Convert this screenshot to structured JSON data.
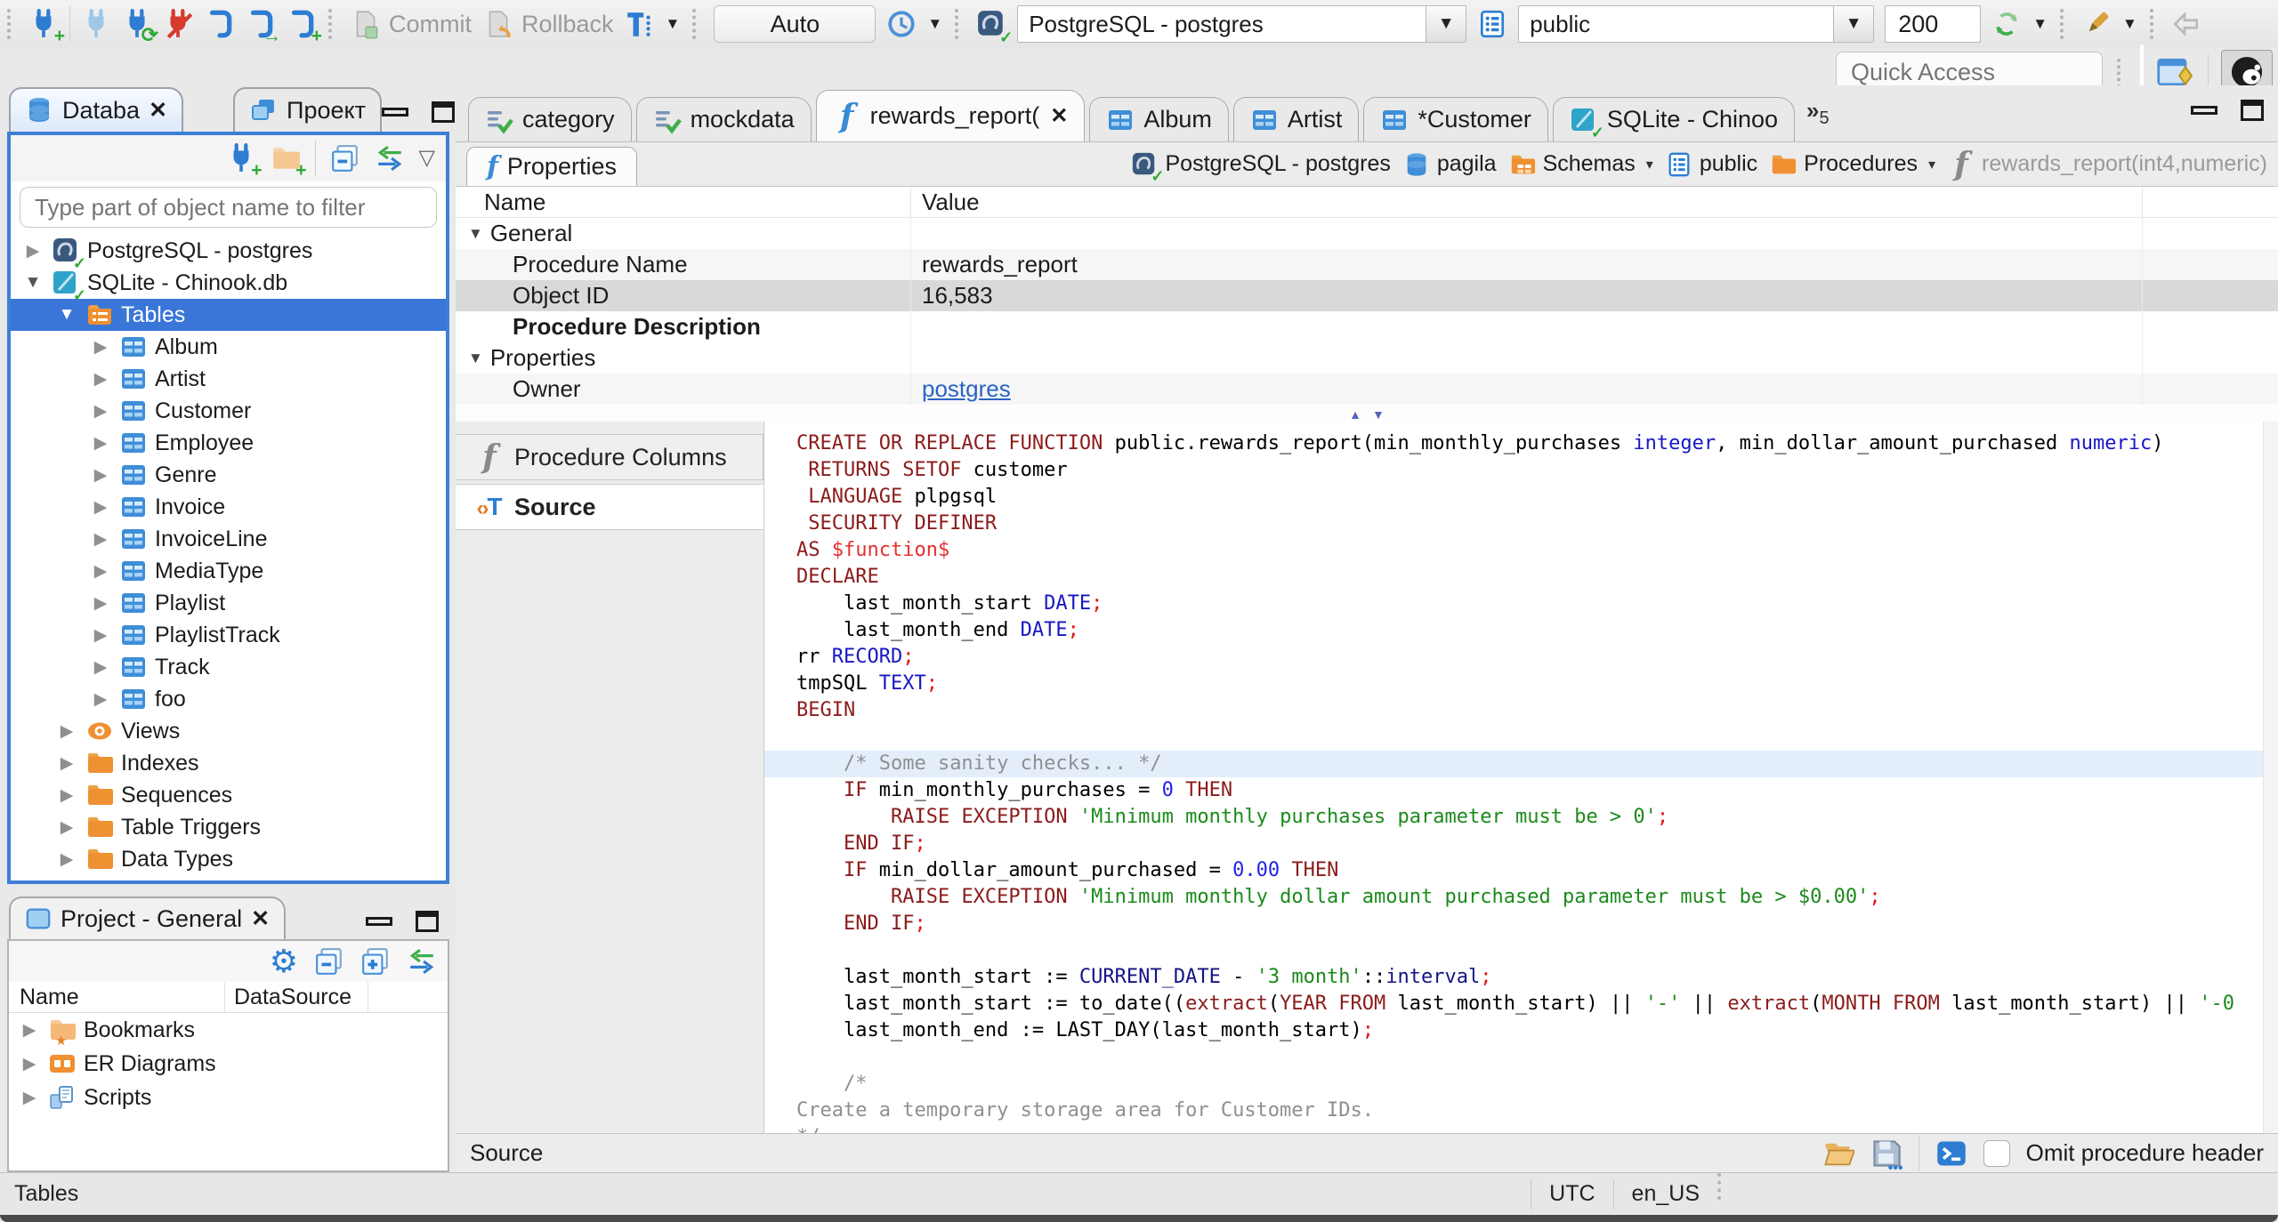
{
  "toolbar": {
    "commit_label": "Commit",
    "rollback_label": "Rollback",
    "auto_label": "Auto",
    "connection_value": "PostgreSQL - postgres",
    "schema_value": "public",
    "fetch_size_value": "200",
    "quick_access_placeholder": "Quick Access"
  },
  "icons": {
    "gear": "⚙",
    "menu-down": "▽",
    "close": "✕",
    "expander-collapsed": "▶",
    "expander-expanded": "▼",
    "dropdown": "▾",
    "sash-up": "▲",
    "sash-down": "▼",
    "tab-overflow": "»"
  },
  "navigator": {
    "tab_database": "Databa",
    "tab_projects": "Проект",
    "filter_placeholder": "Type part of object name to filter",
    "tree": [
      {
        "label": "PostgreSQL - postgres",
        "icon": "postgres",
        "level": 0,
        "expander": "collapsed"
      },
      {
        "label": "SQLite - Chinook.db",
        "icon": "sqlite",
        "level": 0,
        "expander": "expanded"
      },
      {
        "label": "Tables",
        "icon": "tables-folder",
        "level": 1,
        "expander": "expanded",
        "selected": true
      },
      {
        "label": "Album",
        "icon": "table",
        "level": 2,
        "expander": "collapsed"
      },
      {
        "label": "Artist",
        "icon": "table",
        "level": 2,
        "expander": "collapsed"
      },
      {
        "label": "Customer",
        "icon": "table",
        "level": 2,
        "expander": "collapsed"
      },
      {
        "label": "Employee",
        "icon": "table",
        "level": 2,
        "expander": "collapsed"
      },
      {
        "label": "Genre",
        "icon": "table",
        "level": 2,
        "expander": "collapsed"
      },
      {
        "label": "Invoice",
        "icon": "table",
        "level": 2,
        "expander": "collapsed"
      },
      {
        "label": "InvoiceLine",
        "icon": "table",
        "level": 2,
        "expander": "collapsed"
      },
      {
        "label": "MediaType",
        "icon": "table",
        "level": 2,
        "expander": "collapsed"
      },
      {
        "label": "Playlist",
        "icon": "table",
        "level": 2,
        "expander": "collapsed"
      },
      {
        "label": "PlaylistTrack",
        "icon": "table",
        "level": 2,
        "expander": "collapsed"
      },
      {
        "label": "Track",
        "icon": "table",
        "level": 2,
        "expander": "collapsed"
      },
      {
        "label": "foo",
        "icon": "table",
        "level": 2,
        "expander": "collapsed"
      },
      {
        "label": "Views",
        "icon": "views-eye",
        "level": 1,
        "expander": "collapsed"
      },
      {
        "label": "Indexes",
        "icon": "folder",
        "level": 1,
        "expander": "collapsed"
      },
      {
        "label": "Sequences",
        "icon": "folder",
        "level": 1,
        "expander": "collapsed"
      },
      {
        "label": "Table Triggers",
        "icon": "folder",
        "level": 1,
        "expander": "collapsed"
      },
      {
        "label": "Data Types",
        "icon": "folder",
        "level": 1,
        "expander": "collapsed"
      }
    ]
  },
  "project_panel": {
    "title": "Project - General",
    "columns": [
      "Name",
      "DataSource"
    ],
    "tree": [
      {
        "label": "Bookmarks",
        "icon": "folder-bookmarks"
      },
      {
        "label": "ER Diagrams",
        "icon": "er-diagrams"
      },
      {
        "label": "Scripts",
        "icon": "scripts"
      }
    ]
  },
  "editor_tabs": {
    "tabs": [
      {
        "label": "category",
        "icon": "sql-script"
      },
      {
        "label": "mockdata",
        "icon": "sql-script"
      },
      {
        "label": "rewards_report(",
        "icon": "function",
        "active": true,
        "closable": true
      },
      {
        "label": "Album",
        "icon": "table"
      },
      {
        "label": "Artist",
        "icon": "table"
      },
      {
        "label": "*Customer",
        "icon": "table"
      },
      {
        "label": "SQLite - Chinoo",
        "icon": "sqlite"
      }
    ],
    "overflow_count": "5"
  },
  "properties_view": {
    "tab_label": "Properties",
    "breadcrumb": [
      {
        "label": "PostgreSQL - postgres",
        "icon": "postgres"
      },
      {
        "label": "pagila",
        "icon": "database"
      },
      {
        "label": "Schemas",
        "icon": "folder-schemas",
        "dropdown": true
      },
      {
        "label": "public",
        "icon": "schema"
      },
      {
        "label": "Procedures",
        "icon": "folder",
        "dropdown": true
      },
      {
        "label": "rewards_report(int4,numeric)",
        "icon": "function-gray",
        "muted": true
      }
    ],
    "columns": [
      "Name",
      "Value"
    ],
    "rows": [
      {
        "type": "group",
        "label": "General"
      },
      {
        "type": "item",
        "label": "Procedure Name",
        "value": "rewards_report",
        "shade": true
      },
      {
        "type": "item",
        "label": "Object ID",
        "value": "16,583",
        "selected": true
      },
      {
        "type": "item",
        "label": "Procedure Description",
        "value": "",
        "bold": true
      },
      {
        "type": "group",
        "label": "Properties"
      },
      {
        "type": "item",
        "label": "Owner",
        "value": "postgres",
        "link": true,
        "shade": true
      }
    ],
    "subtabs": [
      {
        "label": "Procedure Columns",
        "icon": "function-gray"
      },
      {
        "label": "Source",
        "icon": "source-tag",
        "active": true
      }
    ]
  },
  "source_editor": {
    "status_label": "Source",
    "omit_checkbox_label": "Omit procedure header",
    "lines": [
      {
        "seg": [
          [
            "k",
            "CREATE OR REPLACE FUNCTION"
          ],
          [
            "b",
            " public.rewards_report(min_monthly_purchases "
          ],
          [
            "t",
            "integer"
          ],
          [
            "b",
            ", min_dollar_amount_purchased "
          ],
          [
            "t",
            "numeric"
          ],
          [
            "b",
            ")"
          ]
        ]
      },
      {
        "seg": [
          [
            "b",
            " "
          ],
          [
            "k",
            "RETURNS SETOF"
          ],
          [
            "b",
            " customer"
          ]
        ]
      },
      {
        "seg": [
          [
            "b",
            " "
          ],
          [
            "k",
            "LANGUAGE"
          ],
          [
            "b",
            " plpgsql"
          ]
        ]
      },
      {
        "seg": [
          [
            "b",
            " "
          ],
          [
            "k",
            "SECURITY DEFINER"
          ]
        ]
      },
      {
        "seg": [
          [
            "k",
            "AS"
          ],
          [
            "b",
            " "
          ],
          [
            "d",
            "$function$"
          ]
        ]
      },
      {
        "seg": [
          [
            "k",
            "DECLARE"
          ]
        ]
      },
      {
        "seg": [
          [
            "b",
            "    last_month_start "
          ],
          [
            "t",
            "DATE"
          ],
          [
            "r",
            ";"
          ]
        ]
      },
      {
        "seg": [
          [
            "b",
            "    last_month_end "
          ],
          [
            "t",
            "DATE"
          ],
          [
            "r",
            ";"
          ]
        ]
      },
      {
        "seg": [
          [
            "b",
            "rr "
          ],
          [
            "t",
            "RECORD"
          ],
          [
            "r",
            ";"
          ]
        ]
      },
      {
        "seg": [
          [
            "b",
            "tmpSQL "
          ],
          [
            "t",
            "TEXT"
          ],
          [
            "r",
            ";"
          ]
        ]
      },
      {
        "seg": [
          [
            "k",
            "BEGIN"
          ]
        ]
      },
      {
        "seg": []
      },
      {
        "hl": true,
        "seg": [
          [
            "b",
            "    "
          ],
          [
            "c",
            "/* Some sanity checks... */"
          ]
        ]
      },
      {
        "seg": [
          [
            "b",
            "    "
          ],
          [
            "k",
            "IF"
          ],
          [
            "b",
            " min_monthly_purchases = "
          ],
          [
            "n",
            "0"
          ],
          [
            "b",
            " "
          ],
          [
            "k",
            "THEN"
          ]
        ]
      },
      {
        "seg": [
          [
            "b",
            "        "
          ],
          [
            "k",
            "RAISE EXCEPTION"
          ],
          [
            "b",
            " "
          ],
          [
            "s",
            "'Minimum monthly purchases parameter must be > 0'"
          ],
          [
            "r",
            ";"
          ]
        ]
      },
      {
        "seg": [
          [
            "b",
            "    "
          ],
          [
            "k",
            "END IF"
          ],
          [
            "r",
            ";"
          ]
        ]
      },
      {
        "seg": [
          [
            "b",
            "    "
          ],
          [
            "k",
            "IF"
          ],
          [
            "b",
            " min_dollar_amount_purchased = "
          ],
          [
            "n",
            "0.00"
          ],
          [
            "b",
            " "
          ],
          [
            "k",
            "THEN"
          ]
        ]
      },
      {
        "seg": [
          [
            "b",
            "        "
          ],
          [
            "k",
            "RAISE EXCEPTION"
          ],
          [
            "b",
            " "
          ],
          [
            "s",
            "'Minimum monthly dollar amount purchased parameter must be > $0.00'"
          ],
          [
            "r",
            ";"
          ]
        ]
      },
      {
        "seg": [
          [
            "b",
            "    "
          ],
          [
            "k",
            "END IF"
          ],
          [
            "r",
            ";"
          ]
        ]
      },
      {
        "seg": []
      },
      {
        "seg": [
          [
            "b",
            "    last_month_start := "
          ],
          [
            "v",
            "CURRENT_DATE"
          ],
          [
            "b",
            " - "
          ],
          [
            "s",
            "'3 month'"
          ],
          [
            "b",
            "::"
          ],
          [
            "v",
            "interval"
          ],
          [
            "r",
            ";"
          ]
        ]
      },
      {
        "seg": [
          [
            "b",
            "    last_month_start := to_date(("
          ],
          [
            "k",
            "extract"
          ],
          [
            "b",
            "("
          ],
          [
            "k",
            "YEAR FROM"
          ],
          [
            "b",
            " last_month_start) || "
          ],
          [
            "s",
            "'-'"
          ],
          [
            "b",
            " || "
          ],
          [
            "k",
            "extract"
          ],
          [
            "b",
            "("
          ],
          [
            "k",
            "MONTH FROM"
          ],
          [
            "b",
            " last_month_start) || "
          ],
          [
            "s",
            "'-0"
          ]
        ]
      },
      {
        "seg": [
          [
            "b",
            "    last_month_end := LAST_DAY(last_month_start)"
          ],
          [
            "r",
            ";"
          ]
        ]
      },
      {
        "seg": []
      },
      {
        "seg": [
          [
            "b",
            "    "
          ],
          [
            "c",
            "/*"
          ]
        ]
      },
      {
        "seg": [
          [
            "c",
            "Create a temporary storage area for Customer IDs."
          ]
        ]
      },
      {
        "seg": [
          [
            "c",
            "*/"
          ]
        ]
      }
    ]
  },
  "statusbar": {
    "left": "Tables",
    "timezone": "UTC",
    "locale": "en_US"
  }
}
